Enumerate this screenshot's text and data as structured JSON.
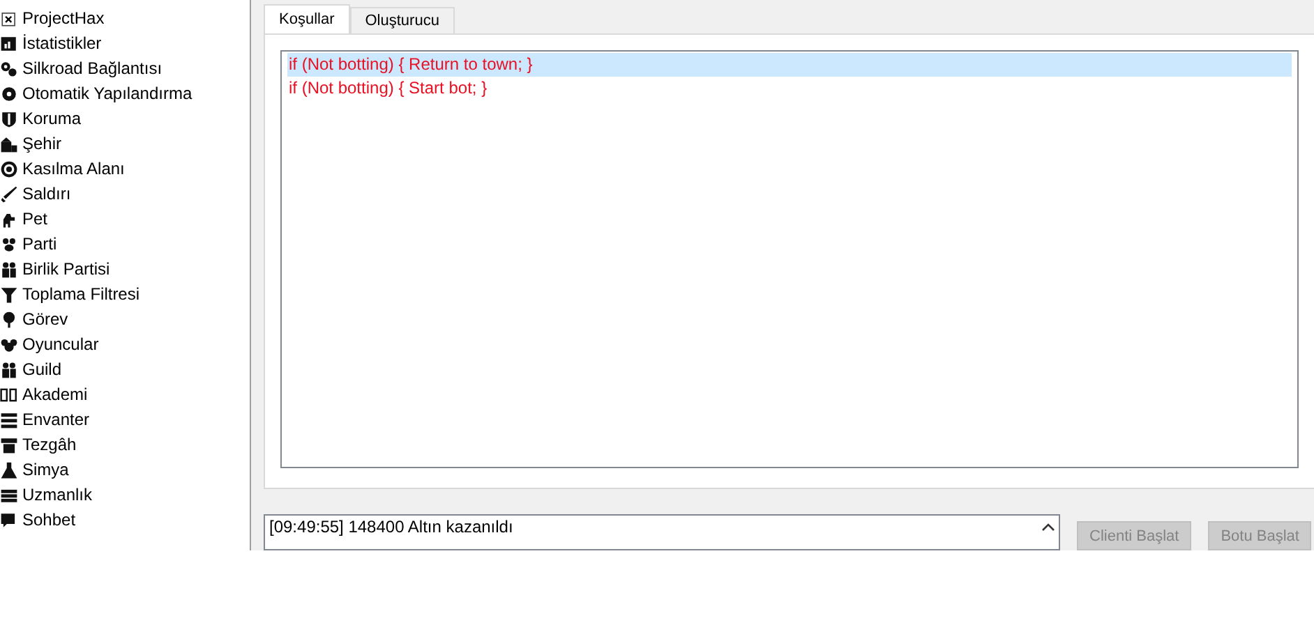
{
  "sidebar": {
    "items": [
      {
        "label": "ProjectHax"
      },
      {
        "label": "İstatistikler"
      },
      {
        "label": "Silkroad Bağlantısı"
      },
      {
        "label": "Otomatik Yapılandırma"
      },
      {
        "label": "Koruma"
      },
      {
        "label": "Şehir"
      },
      {
        "label": "Kasılma Alanı"
      },
      {
        "label": "Saldırı"
      },
      {
        "label": "Pet"
      },
      {
        "label": "Parti"
      },
      {
        "label": "Birlik Partisi"
      },
      {
        "label": "Toplama Filtresi"
      },
      {
        "label": "Görev"
      },
      {
        "label": "Oyuncular"
      },
      {
        "label": "Guild"
      },
      {
        "label": "Akademi"
      },
      {
        "label": "Envanter"
      },
      {
        "label": "Tezgâh"
      },
      {
        "label": "Simya"
      },
      {
        "label": "Uzmanlık"
      },
      {
        "label": "Sohbet"
      }
    ]
  },
  "tabs": [
    {
      "label": "Koşullar",
      "selected": true
    },
    {
      "label": "Oluşturucu",
      "selected": false
    }
  ],
  "conditions": [
    {
      "text": "if (Not botting) { Return to town; }",
      "selected": true
    },
    {
      "text": "if (Not botting) { Start bot; }",
      "selected": false
    }
  ],
  "log": [
    "[09:49:55] 148400 Altın kazanıldı"
  ],
  "buttons": [
    {
      "label": "Clienti Başlat",
      "disabled": true
    },
    {
      "label": "Botu Başlat",
      "disabled": true
    }
  ]
}
